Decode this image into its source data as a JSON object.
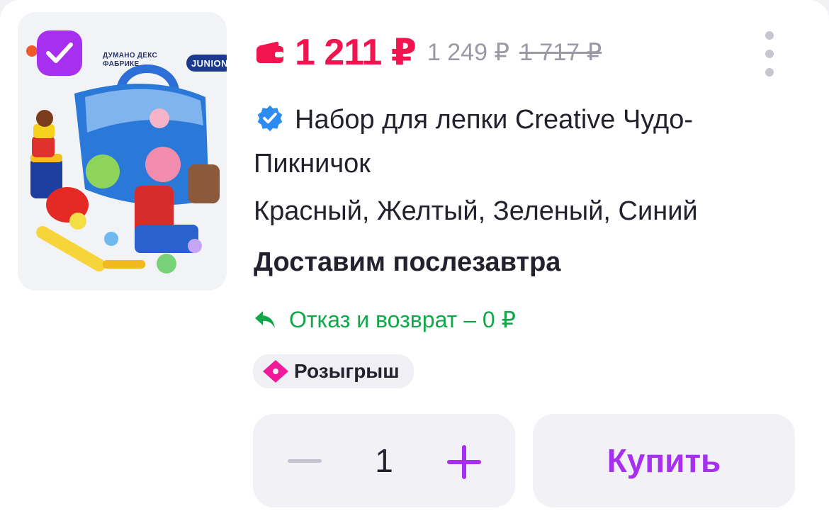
{
  "product": {
    "price": "1 211 ₽",
    "price_secondary": "1 249 ₽",
    "price_old": "1 717 ₽",
    "title": "Набор для лепки Creative Чудо-Пикничок",
    "colors": "Красный, Желтый, Зеленый, Синий",
    "delivery": "Доставим послезавтра",
    "return_policy": "Отказ и возврат – 0 ₽",
    "badge": "Розыгрыш",
    "selected": true,
    "image_brand_text": "ДУМАНО ДЕКС ФАБРИКЕ",
    "image_logo_text": "JUNION"
  },
  "cart": {
    "quantity": "1",
    "buy_label": "Купить"
  },
  "colors": {
    "price": "#f0144f",
    "accent": "#a72ff0",
    "return": "#12a84a",
    "verified": "#2c8cf2",
    "badge_icon": "#f0199a"
  },
  "icons": {
    "wallet": "wallet-icon",
    "verified": "verified-check-icon",
    "return": "return-arrow-icon",
    "ticket": "ticket-icon",
    "menu": "more-vertical-icon",
    "checkbox": "checkmark-icon",
    "minus": "minus-icon",
    "plus": "plus-icon"
  }
}
